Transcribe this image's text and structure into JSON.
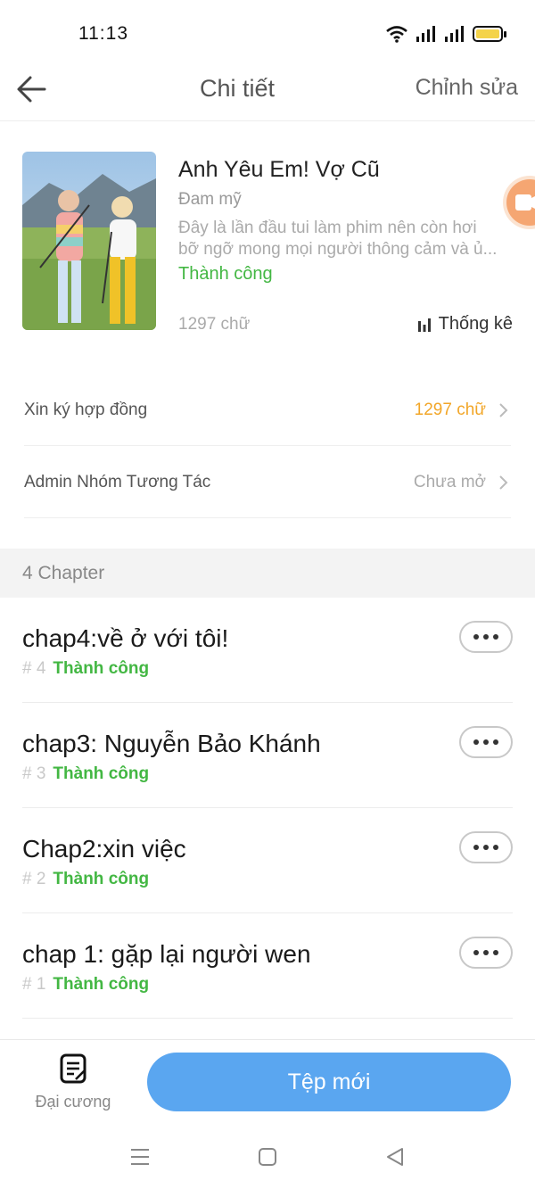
{
  "status_bar": {
    "time": "11:13",
    "icons": [
      "wifi-icon",
      "signal-icon",
      "signal-icon",
      "battery-icon"
    ],
    "battery_color": "#f4d34a"
  },
  "header": {
    "title": "Chi tiết",
    "edit_label": "Chỉnh sửa",
    "back_icon": "back-arrow-icon"
  },
  "book": {
    "title": "Anh Yêu Em! Vợ Cũ",
    "genre": "Đam mỹ",
    "description_line1": "Đây là lần đầu tui làm phim nên còn hơi",
    "description_line2": "bỡ ngỡ mong mọi người thông cảm và ủ...",
    "status": "Thành công",
    "word_count": "1297 chữ",
    "stats_label": "Thống kê"
  },
  "settings": [
    {
      "label": "Xin ký hợp đồng",
      "value": "1297 chữ",
      "value_color": "#f2a628"
    },
    {
      "label": "Admin Nhóm Tương Tác",
      "value": "Chưa mở",
      "value_color": "#aaaaaa"
    }
  ],
  "chapters_header": "4 Chapter",
  "chapters": [
    {
      "title": "chap4:về ở với tôi!",
      "number": "# 4",
      "status": "Thành công"
    },
    {
      "title": "chap3: Nguyễn Bảo Khánh",
      "number": "# 3",
      "status": "Thành công"
    },
    {
      "title": "Chap2:xin việc",
      "number": "# 2",
      "status": "Thành công"
    },
    {
      "title": "chap 1: gặp lại người wen",
      "number": "# 1",
      "status": "Thành công"
    }
  ],
  "bottom_bar": {
    "outline_label": "Đại cương",
    "new_file_label": "Tệp mới",
    "accent": "#5aa6f0"
  },
  "colors": {
    "success": "#43b743",
    "warning": "#f2a628"
  }
}
